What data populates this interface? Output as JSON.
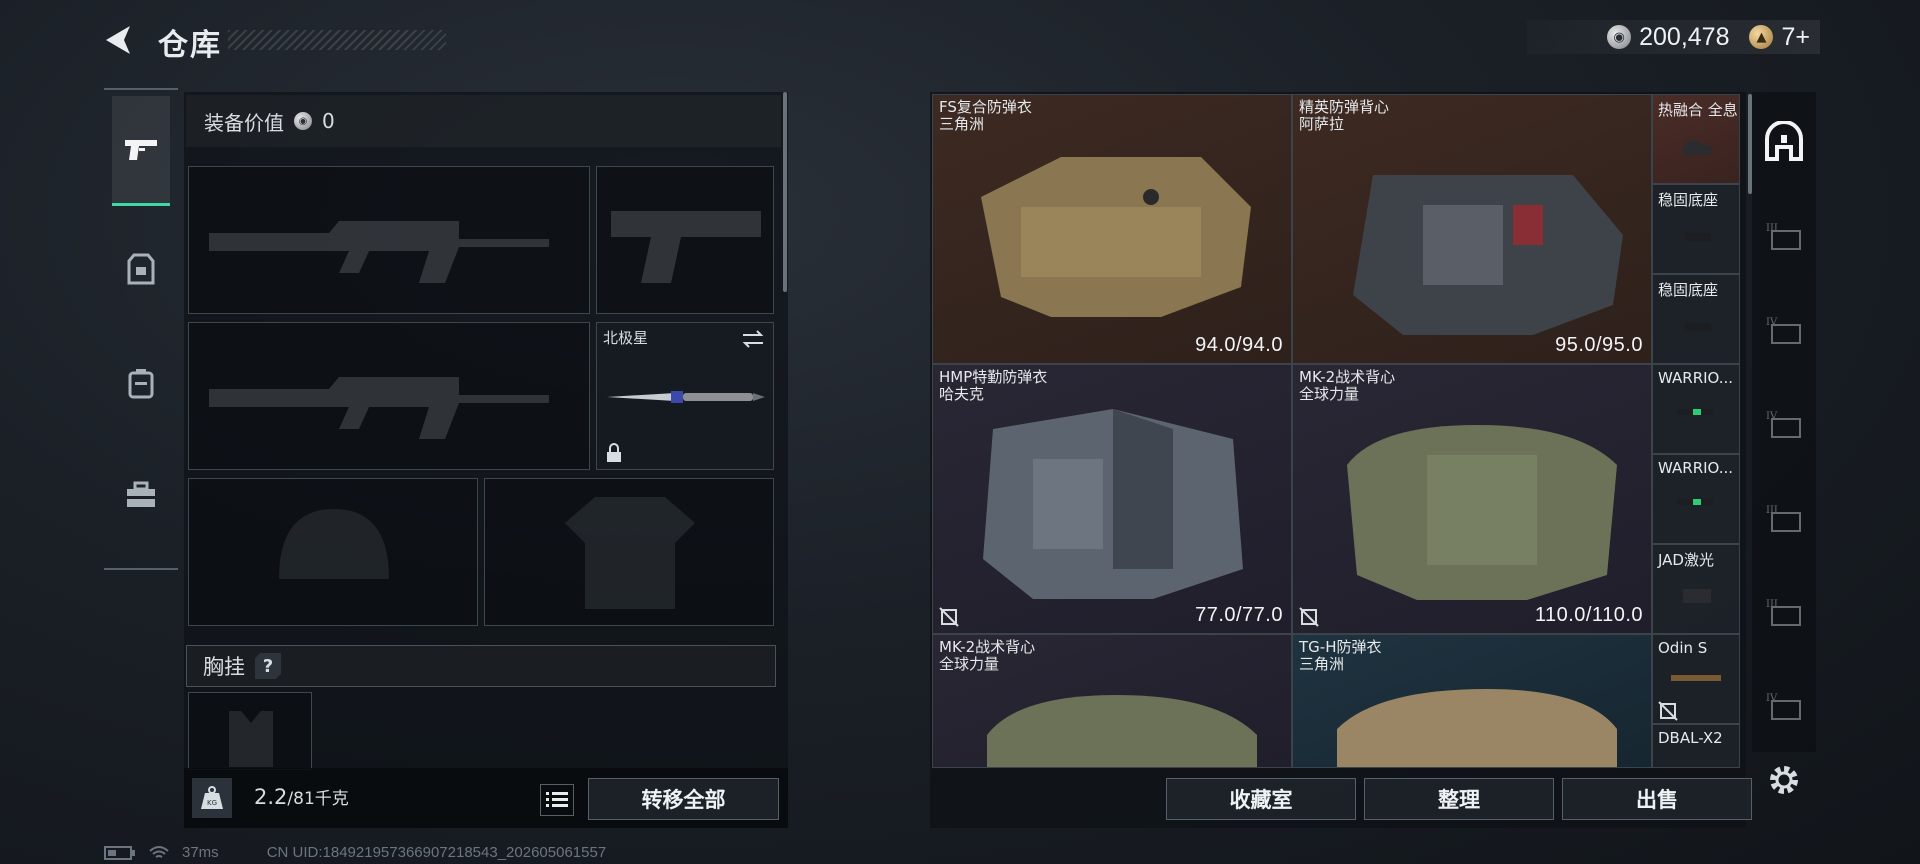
{
  "header": {
    "title": "仓库",
    "silver_amount": "200,478",
    "gold_amount": "7+"
  },
  "equipment": {
    "value_label": "装备价值",
    "value": "0",
    "melee_name": "北极星",
    "chest_rig_label": "胸挂",
    "help_label": "?",
    "weight_current": "2.2",
    "weight_max": "/81千克",
    "transfer_all_label": "转移全部"
  },
  "storage": {
    "items": [
      {
        "name": "FS复合防弹衣",
        "sub": "三角洲",
        "durability": "94.0/94.0"
      },
      {
        "name": "精英防弹背心",
        "sub": "阿萨拉",
        "durability": "95.0/95.0"
      },
      {
        "name": "HMP特勤防弹衣",
        "sub": "哈夫克",
        "durability": "77.0/77.0"
      },
      {
        "name": "MK-2战术背心",
        "sub": "全球力量",
        "durability": "110.0/110.0"
      },
      {
        "name": "MK-2战术背心",
        "sub": "全球力量",
        "durability": ""
      },
      {
        "name": "TG-H防弹衣",
        "sub": "三角洲",
        "durability": ""
      }
    ],
    "minis": [
      {
        "name": "热融合 全息"
      },
      {
        "name": "稳固底座"
      },
      {
        "name": "稳固底座"
      },
      {
        "name": "WARRIO..."
      },
      {
        "name": "WARRIO..."
      },
      {
        "name": "JAD激光"
      },
      {
        "name": "Odin S"
      },
      {
        "name": "DBAL-X2"
      }
    ],
    "collection_label": "收藏室",
    "sort_label": "整理",
    "sell_label": "出售"
  },
  "status": {
    "ping": "37ms",
    "uid": "CN UID:18492195736690721854​3_202605061557"
  },
  "colors": {
    "accent_green": "#3fd9a5",
    "rare_bg": "#3d2a22",
    "epic_bg": "#2a2735",
    "blue_bg": "#1f3340"
  }
}
